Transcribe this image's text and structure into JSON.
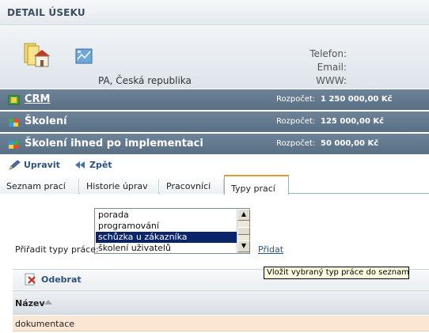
{
  "header": {
    "title": "DETAIL ÚSEKU"
  },
  "info": {
    "location": "PA, Česká republika",
    "phone_label": "Telefon:",
    "email_label": "Email:",
    "www_label": "WWW:"
  },
  "bars": [
    {
      "title": "CRM",
      "budget_label": "Rozpočet:",
      "budget": "1 250 000,00 Kč"
    },
    {
      "title": "Školení",
      "budget_label": "Rozpočet:",
      "budget": "125 000,00 Kč"
    },
    {
      "title": "Školení ihned po implementaci",
      "budget_label": "Rozpočet:",
      "budget": "50 000,00 Kč"
    }
  ],
  "actions": {
    "edit": "Upravit",
    "back": "Zpět"
  },
  "tabs": [
    {
      "label": "Seznam prací"
    },
    {
      "label": "Historie úprav"
    },
    {
      "label": "Pracovníci"
    },
    {
      "label": "Typy prací",
      "active": true
    }
  ],
  "assign": {
    "label": "Přiřadit typy práce:",
    "options": [
      "porada",
      "programování",
      "schůzka u zákazníka",
      "školení uživatelů"
    ],
    "selected": "schůzka u zákazníka",
    "add_link": "Přidat",
    "tooltip": "Vložit vybraný typ práce do seznamu"
  },
  "grid": {
    "remove_label": "Odebrat",
    "column_header": "Název",
    "rows": [
      {
        "name": "dokumentace"
      }
    ]
  },
  "colors": {
    "bar_background": "#5d7489",
    "selected_option": "#0a246a",
    "active_tab_accent": "#e39a2c",
    "row_highlight": "#fbe6d3",
    "link": "#2c5380"
  }
}
